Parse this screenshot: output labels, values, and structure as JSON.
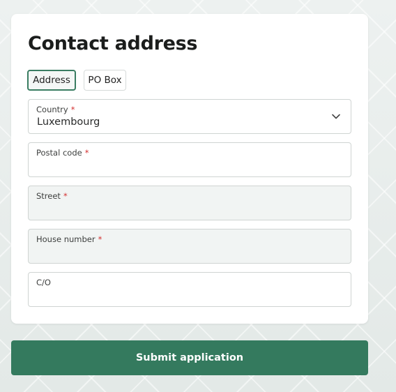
{
  "form": {
    "title": "Contact address",
    "address_type": {
      "options": [
        "Address",
        "PO Box"
      ],
      "selected": "Address"
    },
    "required_marker": "*",
    "fields": {
      "country": {
        "label": "Country",
        "required": true,
        "value": "Luxembourg",
        "icon": "chevron-down-icon"
      },
      "postal_code": {
        "label": "Postal code",
        "required": true,
        "value": ""
      },
      "street": {
        "label": "Street",
        "required": true,
        "value": ""
      },
      "house_number": {
        "label": "House number",
        "required": true,
        "value": ""
      },
      "care_of": {
        "label": "C/O",
        "required": false,
        "value": ""
      }
    }
  },
  "actions": {
    "submit_label": "Submit application"
  },
  "colors": {
    "accent": "#347a5e",
    "selected_border": "#3a7d62",
    "required": "#d32f2f",
    "disabled_field_bg": "#f1f4f3",
    "page_bg": "#e8eeec"
  }
}
